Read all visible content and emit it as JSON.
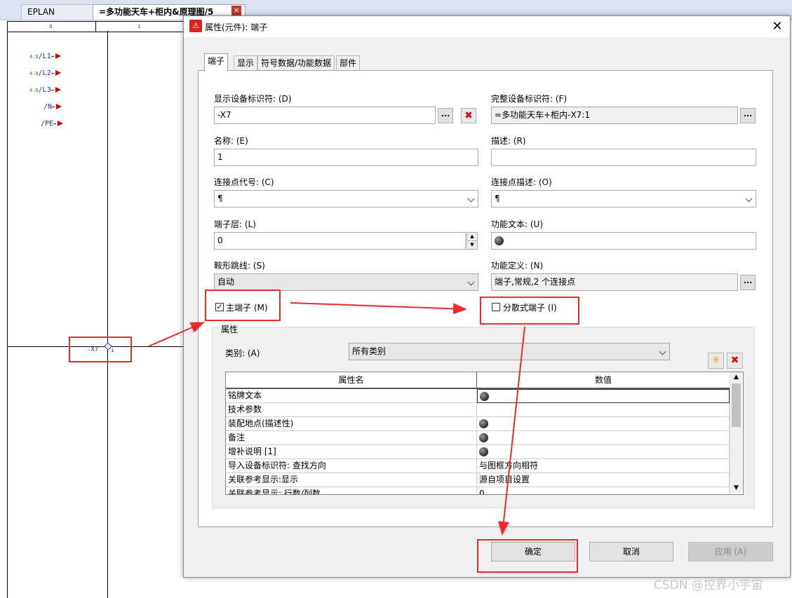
{
  "editor": {
    "tabs": [
      "EPLAN Tutorials",
      "=多功能天车+柜内&原理图/5"
    ],
    "ruler_labels": [
      "0",
      "1"
    ],
    "connectors": [
      {
        "ref": "4.9",
        "label": "/L1"
      },
      {
        "ref": "4.9",
        "label": "/L2"
      },
      {
        "ref": "4.9",
        "label": "/L3"
      },
      {
        "ref": "",
        "label": "/N"
      },
      {
        "ref": "",
        "label": "/PE"
      }
    ],
    "terminal_tag": "-X7",
    "terminal_pin": "1"
  },
  "dialog": {
    "title": "属性(元件): 端子",
    "tabs": [
      "端子",
      "显示",
      "符号数据/功能数据",
      "部件"
    ],
    "fields": {
      "display_id_label": "显示设备标识符: (D)",
      "display_id_value": "-X7",
      "full_id_label": "完整设备标识符: (F)",
      "full_id_value": "=多功能天车+柜内-X7:1",
      "name_label": "名称: (E)",
      "name_value": "1",
      "desc_label": "描述: (R)",
      "desc_value": "",
      "conn_code_label": "连接点代号: (C)",
      "conn_code_value": "¶",
      "conn_desc_label": "连接点描述: (O)",
      "conn_desc_value": "¶",
      "layer_label": "端子层: (L)",
      "layer_value": "0",
      "func_text_label": "功能文本: (U)",
      "jumper_label": "鞍形跳线: (S)",
      "jumper_value": "自动",
      "func_def_label": "功能定义: (N)",
      "func_def_value": "端子,常规,2 个连接点"
    },
    "main_terminal": {
      "label": "主端子 (M)",
      "checked": true
    },
    "distributed_terminal": {
      "label": "分散式端子 (I)",
      "checked": false
    },
    "group_title": "属性",
    "category_label": "类别: (A)",
    "category_value": "所有类别",
    "grid_headers": [
      "属性名",
      "数值"
    ],
    "grid_rows": [
      {
        "name": "铭牌文本",
        "value": "",
        "globe": true
      },
      {
        "name": "技术参数",
        "value": "",
        "globe": false
      },
      {
        "name": "装配地点(描述性)",
        "value": "",
        "globe": true
      },
      {
        "name": "备注",
        "value": "",
        "globe": true
      },
      {
        "name": "增补说明 [1]",
        "value": "",
        "globe": true
      },
      {
        "name": "导入设备标识符: 查找方向",
        "value": "与图框方向相符",
        "globe": false
      },
      {
        "name": "关联参考显示:显示",
        "value": "源自项目设置",
        "globe": false
      },
      {
        "name": "关联参考显示: 行数/列数",
        "value": "0",
        "globe": false
      }
    ],
    "buttons": {
      "ok": "确定",
      "cancel": "取消",
      "apply": "应用 (A)"
    }
  },
  "watermark": "CSDN @控界小宇宙",
  "colors": {
    "annotation_red": "#ee2a2a",
    "accent_blue": "#1a2fd1"
  }
}
